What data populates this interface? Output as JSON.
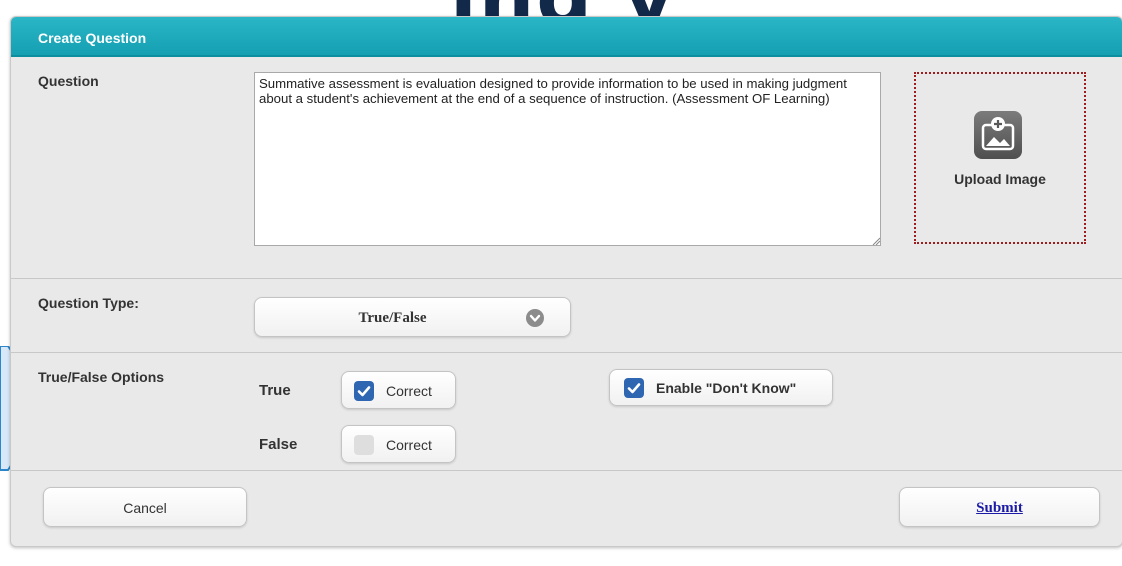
{
  "background": {
    "headline_fragment": "ing      y"
  },
  "panel": {
    "title": "Create Question"
  },
  "question": {
    "label": "Question",
    "value": "Summative assessment is evaluation designed to provide information to be used in making judgment about a student's achievement at the end of a sequence of instruction. (Assessment OF Learning)",
    "upload_label": "Upload Image",
    "upload_icon": "image-add-icon"
  },
  "question_type": {
    "label": "Question Type:",
    "selected": "True/False",
    "dropdown_icon": "chevron-down-icon"
  },
  "tf_options": {
    "label": "True/False Options",
    "true_label": "True",
    "false_label": "False",
    "true_correct_label": "Correct",
    "true_correct_checked": true,
    "false_correct_label": "Correct",
    "false_correct_checked": false,
    "dont_know_label": "Enable \"Don't Know\"",
    "dont_know_checked": true
  },
  "actions": {
    "cancel_label": "Cancel",
    "submit_label": "Submit"
  },
  "colors": {
    "header": "#1aa8ba",
    "checkbox_on": "#2f66b1",
    "upload_border": "#a01c1c",
    "submit_link": "#1a1aa6"
  }
}
